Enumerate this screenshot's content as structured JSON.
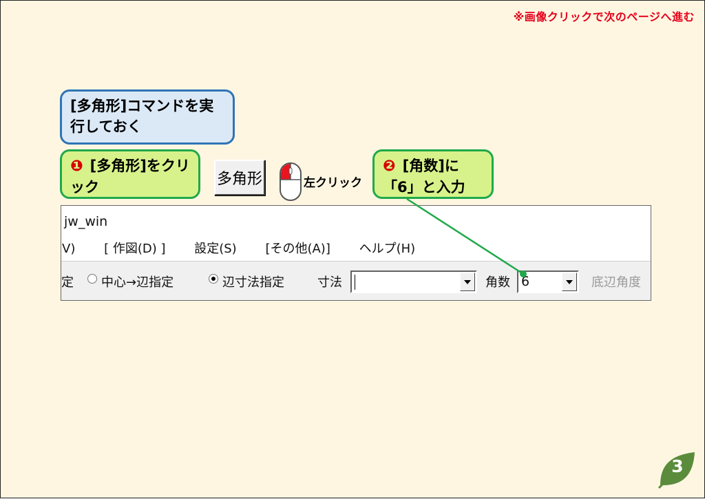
{
  "notice": "※画像クリックで次のページへ進む",
  "callouts": {
    "pre": {
      "text": "[多角形]コマンドを実行しておく"
    },
    "step1": {
      "number": "❶",
      "text": "[多角形]をクリック"
    },
    "step2": {
      "number": "❷",
      "text": "[角数]に「6」と入力"
    }
  },
  "toolbar_button": {
    "label": "多角形"
  },
  "mouse": {
    "label": "左クリック",
    "icon": "mouse-left-click-icon"
  },
  "app": {
    "title": "jw_win",
    "menu": {
      "display": "示(V)",
      "draw": "[ 作図(D) ]",
      "settings": "設定(S)",
      "other": "[その他(A)]",
      "help": "ヘルプ(H)"
    },
    "toolbar": {
      "cut_label": "定",
      "center_mode": "中心→辺指定",
      "side_mode": "辺寸法指定",
      "dimension_label": "寸法",
      "dimension_value": "",
      "corners_label": "角数",
      "corners_value": "6",
      "base_angle_label": "底辺角度"
    }
  },
  "page_number": "3",
  "colors": {
    "background": "#fff6e2",
    "notice": "#e4001a",
    "blue_callout_border": "#2f74b5",
    "green_callout_border": "#20a94a",
    "page_leaf": "#5a8c3c"
  }
}
